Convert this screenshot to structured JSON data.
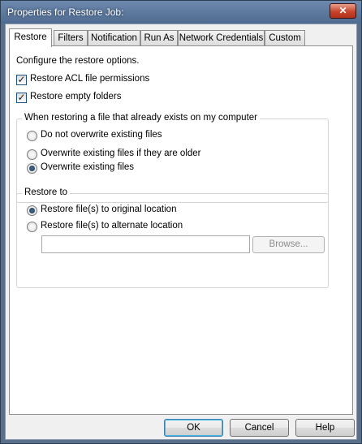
{
  "window": {
    "title": "Properties for Restore Job:",
    "close_glyph": "✕"
  },
  "tabs": [
    {
      "label": "Restore",
      "active": true
    },
    {
      "label": "Filters",
      "active": false
    },
    {
      "label": "Notification",
      "active": false
    },
    {
      "label": "Run As",
      "active": false
    },
    {
      "label": "Network Credentials",
      "active": false
    },
    {
      "label": "Custom",
      "active": false
    }
  ],
  "panel": {
    "intro": "Configure the restore options.",
    "checkboxes": [
      {
        "label": "Restore ACL file permissions",
        "checked": true
      },
      {
        "label": "Restore empty folders",
        "checked": true
      }
    ],
    "existing_group": {
      "title": "When restoring a file that already exists on my computer",
      "options": [
        {
          "label": "Do not overwrite existing files",
          "selected": false
        },
        {
          "label": "Overwrite existing files if they are older",
          "selected": false
        },
        {
          "label": "Overwrite existing files",
          "selected": true
        }
      ]
    },
    "restore_to_group": {
      "title": "Restore to",
      "options": [
        {
          "label": "Restore file(s) to original location",
          "selected": true
        },
        {
          "label": "Restore file(s) to alternate location",
          "selected": false
        }
      ],
      "path_value": "",
      "browse_label": "Browse..."
    }
  },
  "footer": {
    "ok_label": "OK",
    "cancel_label": "Cancel",
    "help_label": "Help"
  },
  "check_glyph": "✓"
}
